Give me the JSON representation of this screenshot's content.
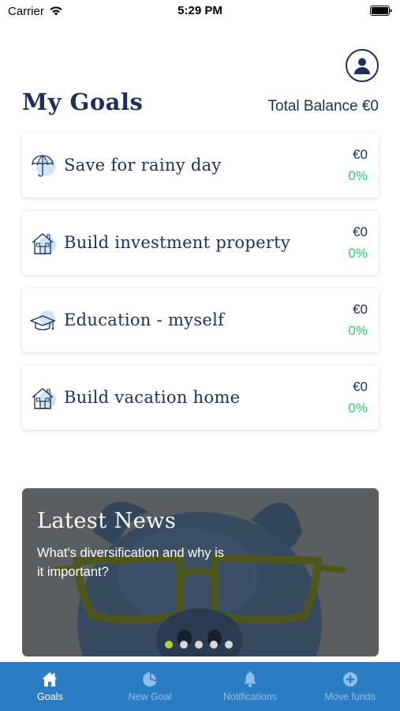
{
  "status_bar": {
    "carrier": "Carrier",
    "time": "5:29 PM"
  },
  "header": {
    "title": "My Goals",
    "total_balance": "Total Balance €0"
  },
  "goals": [
    {
      "name": "Save for rainy day",
      "amount": "€0",
      "percent": "0%",
      "icon": "umbrella-icon"
    },
    {
      "name": "Build investment property",
      "amount": "€0",
      "percent": "0%",
      "icon": "house-icon"
    },
    {
      "name": "Education - myself",
      "amount": "€0",
      "percent": "0%",
      "icon": "graduation-cap-icon"
    },
    {
      "name": "Build vacation home",
      "amount": "€0",
      "percent": "0%",
      "icon": "house-icon"
    }
  ],
  "news": {
    "title": "Latest News",
    "subtitle": "What's diversification and why is it important?",
    "slide_count": 5,
    "active_slide": 1
  },
  "tabs": [
    {
      "label": "Goals",
      "icon": "home-icon",
      "active": true
    },
    {
      "label": "New Goal",
      "icon": "pie-chart-icon",
      "active": false
    },
    {
      "label": "Notifications",
      "icon": "bell-icon",
      "active": false
    },
    {
      "label": "Move funds",
      "icon": "plus-circle-icon",
      "active": false
    }
  ],
  "colors": {
    "navy": "#1d2f5c",
    "green": "#2fcc71",
    "tab_blue": "#2a7dc2",
    "dot_active": "#b8d430"
  }
}
